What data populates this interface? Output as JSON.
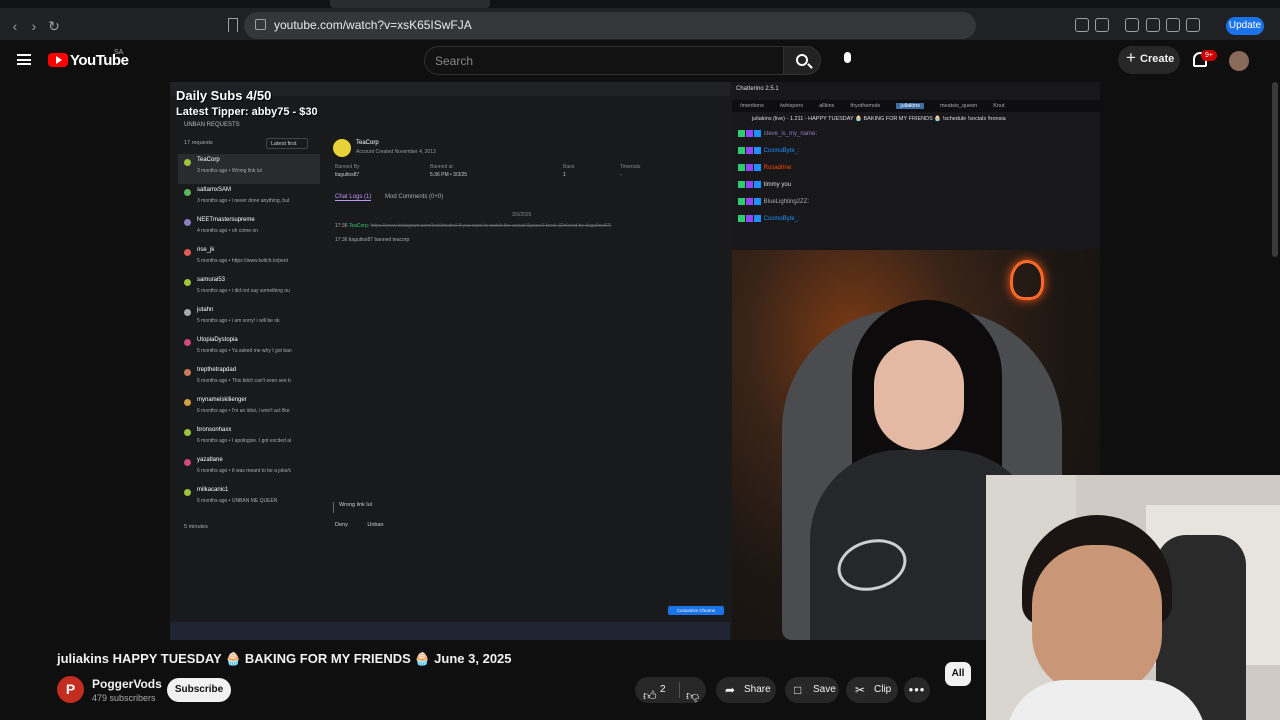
{
  "browser": {
    "url": "youtube.com/watch?v=xsK65ISwFJA",
    "update_label": "Update"
  },
  "header": {
    "logo_text": "YouTube",
    "country_code": "SA",
    "search_placeholder": "Search",
    "create_label": "Create",
    "notifications_badge": "9+"
  },
  "stream": {
    "overlay_subs": "Daily Subs 4/50",
    "overlay_tipper": "Latest Tipper: abby75 - $30",
    "panel_title": "UNBAN REQUESTS",
    "request_count": "17 requests",
    "sort_label": "Latest first",
    "requests": [
      {
        "name": "TeaCorp",
        "msg": "3 months ago • Wrong link lul",
        "color": "#9bc53d"
      },
      {
        "name": "sattamxSAM",
        "msg": "3 months ago • i never done anything, but",
        "color": "#5cb85c"
      },
      {
        "name": "NEETmastersupreme",
        "msg": "4 months ago • oh come on",
        "color": "#8e7cc3"
      },
      {
        "name": "rise_jk",
        "msg": "5 months ago • https://www.twitch.tv/pent",
        "color": "#e05a5a"
      },
      {
        "name": "samurai53",
        "msg": "5 months ago • i did not say something ou",
        "color": "#9bc53d"
      },
      {
        "name": "jutahn",
        "msg": "5 months ago • i am sorry! i will be ok",
        "color": "#aaaaaa"
      },
      {
        "name": "UtopiaDystopia",
        "msg": "5 months ago • Ya asked me why I got ban",
        "color": "#d04a7a"
      },
      {
        "name": "trepthetrapdad",
        "msg": "6 months ago • This bitch can't even see b",
        "color": "#c97a5a"
      },
      {
        "name": "mynameiskilienger",
        "msg": "6 months ago • I'm an idiot, i won't act like",
        "color": "#d0a040"
      },
      {
        "name": "bronsonhaxx",
        "msg": "6 months ago • I apologize. I got excited al",
        "color": "#9bc53d"
      },
      {
        "name": "yazatlane",
        "msg": "6 months ago • It was meant to be a joke/c",
        "color": "#d04a7a"
      },
      {
        "name": "milkacanic1",
        "msg": "6 months ago • UNBAN ME QUEEN",
        "color": "#9bc53d"
      }
    ],
    "time_left": "5 minutes",
    "detail_name": "TeaCorp",
    "detail_created": "Account Created November 4, 2013",
    "stats": [
      {
        "label": "Banned By",
        "value": "tiagultos87"
      },
      {
        "label": "Banned at",
        "value": "5:36 PM • 3/3/25"
      },
      {
        "label": "Bans",
        "value": "1"
      },
      {
        "label": "Timeouts",
        "value": "-"
      }
    ],
    "tab_chat_logs": "Chat Logs (1)",
    "tab_mod_comments": "Mod Comments (0+0)",
    "log_date": "3/3/2025",
    "log1_time": "17:36",
    "log1_user": "TeaCorp:",
    "log1_text": "https://www.instagram.com/kristiimatro/ if you want to watch the actual SpaceX feed. (Deleted by tiagultos87)",
    "log2": "17:36 tiagultos87 banned teacorp",
    "reply": "Wrong link lul",
    "deny_label": "Deny",
    "unban_label": "Unban",
    "customize_label": "Customize Chrome",
    "chat_title": "Chatterino 2.5.1",
    "chat_tabs": [
      "/mentions",
      "/whispers",
      "allkins",
      "thyothemole",
      "juliakins",
      "meatsis_queen",
      "Knut"
    ],
    "chat_header": "juliakins (live) - 1.211 - HAPPY TUESDAY 🧁 BAKING FOR MY FRIENDS 🧁 !schedule !socials !tronsia",
    "chat_lines": [
      {
        "user": "steve_is_my_name:",
        "text": "",
        "color": "#8e7cc3"
      },
      {
        "user": "CosmoByte_:",
        "text": "",
        "color": "#1e90ff"
      },
      {
        "user": "Rosadrine:",
        "text": "",
        "color": "#ff4500"
      },
      {
        "user": "",
        "text": "timmy you",
        "color": "#c71585"
      },
      {
        "user": "BlueLighting2ZZ:",
        "text": "",
        "color": "#aaaaaa"
      },
      {
        "user": "CosmoByte_:",
        "text": "",
        "color": "#1e90ff"
      }
    ]
  },
  "video": {
    "title": "juliakins HAPPY TUESDAY 🧁 BAKING FOR MY FRIENDS 🧁 June 3, 2025",
    "channel_initial": "P",
    "channel_name": "PoggerVods",
    "channel_subs": "479 subscribers",
    "subscribe_label": "Subscribe",
    "like_count": "2",
    "share_label": "Share",
    "save_label": "Save",
    "clip_label": "Clip",
    "chip_all": "All"
  },
  "icons": {
    "menu": "menu-icon",
    "search": "search-icon",
    "mic": "mic-icon",
    "bell": "bell-icon",
    "like": "thumbs-up-icon",
    "dislike": "thumbs-down-icon",
    "share": "share-icon",
    "save": "bookmark-icon",
    "clip": "scissors-icon",
    "more": "more-icon"
  },
  "colors": {
    "brand_red": "#ff0000",
    "accent_blue": "#1a73e8"
  }
}
